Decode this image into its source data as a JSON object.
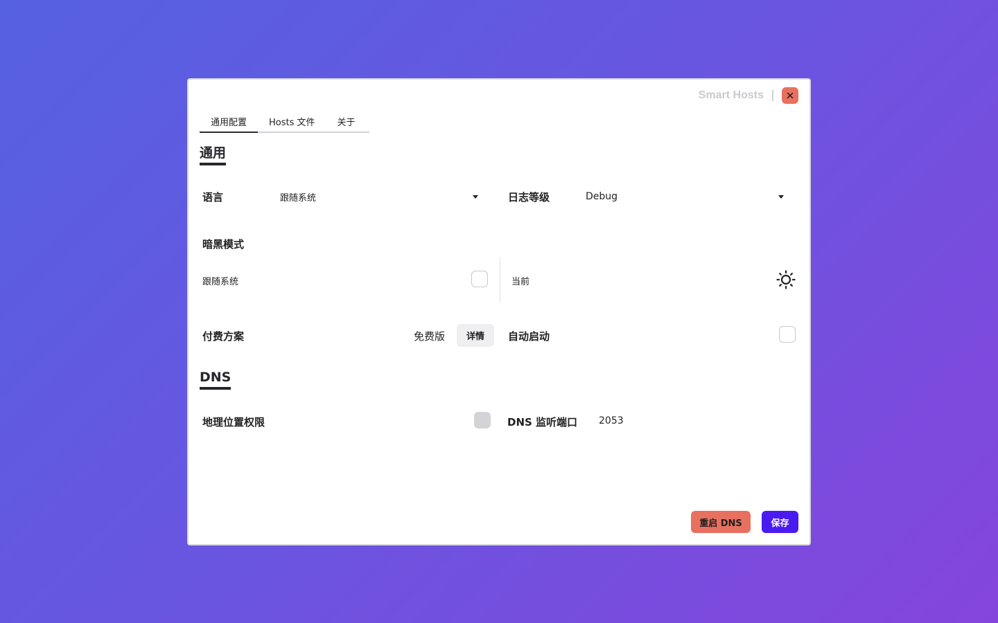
{
  "window": {
    "app_title": "Smart Hosts"
  },
  "tabs": [
    {
      "label": "通用配置",
      "active": true
    },
    {
      "label": "Hosts 文件",
      "active": false
    },
    {
      "label": "关于",
      "active": false
    }
  ],
  "general": {
    "section_title": "通用",
    "language": {
      "label": "语言",
      "value": "跟随系统"
    },
    "log_level": {
      "label": "日志等级",
      "value": "Debug"
    },
    "dark_mode": {
      "label": "暗黑模式",
      "follow_system_label": "跟随系统",
      "follow_system_checked": false,
      "current_label": "当前",
      "current_icon": "sun-icon"
    },
    "plan": {
      "label": "付费方案",
      "value": "免费版",
      "details_label": "详情"
    },
    "auto_start": {
      "label": "自动启动",
      "checked": false
    }
  },
  "dns": {
    "section_title": "DNS",
    "geo_permission": {
      "label": "地理位置权限",
      "checked": false,
      "disabled": true
    },
    "listen_port": {
      "label": "DNS 监听端口",
      "value": "2053"
    }
  },
  "footer": {
    "restart_label": "重启 DNS",
    "save_label": "保存"
  },
  "colors": {
    "accent": "#4a1bf0",
    "danger": "#e8705f",
    "background_start": "#5561e0",
    "background_end": "#8545dc"
  }
}
